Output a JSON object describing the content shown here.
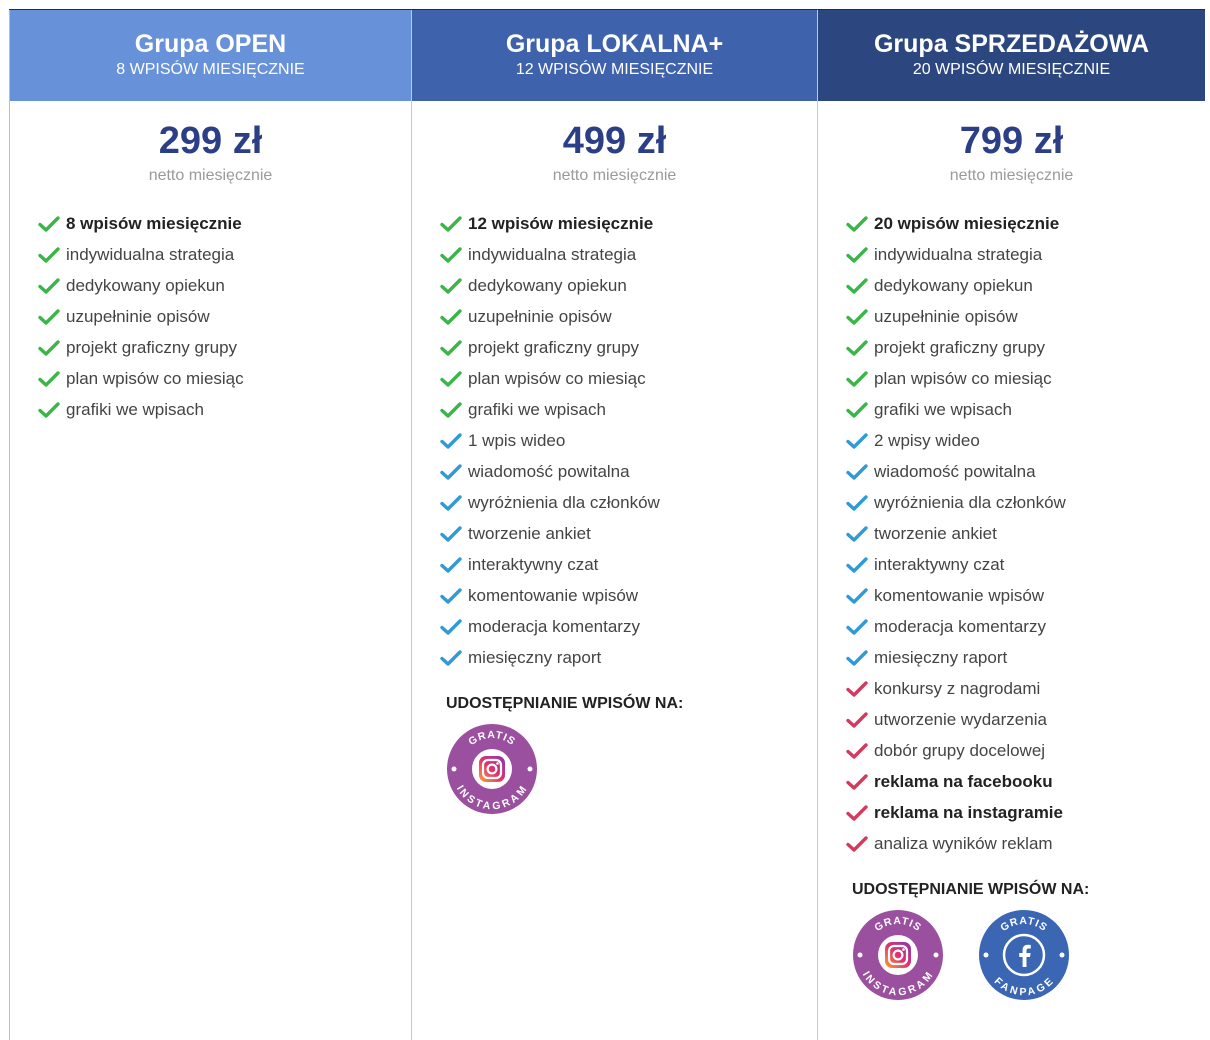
{
  "colors": {
    "check_green": "#3bb54a",
    "check_blue": "#2f9ad6",
    "check_red": "#d23a5e",
    "header_open": "#6791d9",
    "header_lokalna": "#3f62ad",
    "header_sprzedazowa": "#2c477f",
    "price": "#2c3e86"
  },
  "plans": [
    {
      "name": "Grupa OPEN",
      "subtitle": "8 WPISÓW MIESIĘCZNIE",
      "price": "299 zł",
      "price_note": "netto miesięcznie",
      "features": [
        {
          "text": "8 wpisów miesięcznie",
          "bold": true,
          "check": "green"
        },
        {
          "text": "indywidualna strategia",
          "check": "green"
        },
        {
          "text": "dedykowany opiekun",
          "check": "green"
        },
        {
          "text": "uzupełninie opisów",
          "check": "green"
        },
        {
          "text": "projekt graficzny grupy",
          "check": "green"
        },
        {
          "text": "plan wpisów co miesiąc",
          "check": "green"
        },
        {
          "text": "grafiki we wpisach",
          "check": "green"
        }
      ]
    },
    {
      "name": "Grupa LOKALNA+",
      "subtitle": "12 WPISÓW MIESIĘCZNIE",
      "price": "499 zł",
      "price_note": "netto miesięcznie",
      "features": [
        {
          "text": "12 wpisów miesięcznie",
          "bold": true,
          "check": "green"
        },
        {
          "text": "indywidualna strategia",
          "check": "green"
        },
        {
          "text": "dedykowany opiekun",
          "check": "green"
        },
        {
          "text": "uzupełninie opisów",
          "check": "green"
        },
        {
          "text": "projekt graficzny grupy",
          "check": "green"
        },
        {
          "text": "plan wpisów co miesiąc",
          "check": "green"
        },
        {
          "text": "grafiki we wpisach",
          "check": "green"
        },
        {
          "text": "1 wpis wideo",
          "check": "blue"
        },
        {
          "text": "wiadomość powitalna",
          "check": "blue"
        },
        {
          "text": "wyróżnienia dla członków",
          "check": "blue"
        },
        {
          "text": "tworzenie ankiet",
          "check": "blue"
        },
        {
          "text": "interaktywny czat",
          "check": "blue"
        },
        {
          "text": "komentowanie wpisów",
          "check": "blue"
        },
        {
          "text": "moderacja komentarzy",
          "check": "blue"
        },
        {
          "text": "miesięczny raport",
          "check": "blue"
        }
      ],
      "share_heading": "UDOSTĘPNIANIE WPISÓW NA:",
      "badges": [
        {
          "icon": "instagram-icon",
          "top": "GRATIS",
          "bottom": "INSTAGRAM",
          "color": "#9b4f9f"
        }
      ]
    },
    {
      "name": "Grupa SPRZEDAŻOWA",
      "subtitle": "20 WPISÓW MIESIĘCZNIE",
      "price": "799 zł",
      "price_note": "netto miesięcznie",
      "features": [
        {
          "text": "20 wpisów miesięcznie",
          "bold": true,
          "check": "green"
        },
        {
          "text": "indywidualna strategia",
          "check": "green"
        },
        {
          "text": "dedykowany opiekun",
          "check": "green"
        },
        {
          "text": "uzupełninie opisów",
          "check": "green"
        },
        {
          "text": "projekt graficzny grupy",
          "check": "green"
        },
        {
          "text": "plan wpisów co miesiąc",
          "check": "green"
        },
        {
          "text": "grafiki we wpisach",
          "check": "green"
        },
        {
          "text": "2 wpisy wideo",
          "check": "blue"
        },
        {
          "text": "wiadomość powitalna",
          "check": "blue"
        },
        {
          "text": "wyróżnienia dla członków",
          "check": "blue"
        },
        {
          "text": "tworzenie ankiet",
          "check": "blue"
        },
        {
          "text": "interaktywny czat",
          "check": "blue"
        },
        {
          "text": "komentowanie wpisów",
          "check": "blue"
        },
        {
          "text": "moderacja komentarzy",
          "check": "blue"
        },
        {
          "text": "miesięczny raport",
          "check": "blue"
        },
        {
          "text": "konkursy z nagrodami",
          "check": "red"
        },
        {
          "text": "utworzenie wydarzenia",
          "check": "red"
        },
        {
          "text": "dobór grupy docelowej",
          "check": "red"
        },
        {
          "text": "reklama na facebooku",
          "bold": true,
          "check": "red"
        },
        {
          "text": "reklama na instagramie",
          "bold": true,
          "check": "red"
        },
        {
          "text": "analiza wyników reklam",
          "check": "red"
        }
      ],
      "share_heading": "UDOSTĘPNIANIE WPISÓW NA:",
      "badges": [
        {
          "icon": "instagram-icon",
          "top": "GRATIS",
          "bottom": "INSTAGRAM",
          "color": "#9b4f9f"
        },
        {
          "icon": "facebook-icon",
          "top": "GRATIS",
          "bottom": "FANPAGE",
          "color": "#3a66b3"
        }
      ]
    }
  ]
}
